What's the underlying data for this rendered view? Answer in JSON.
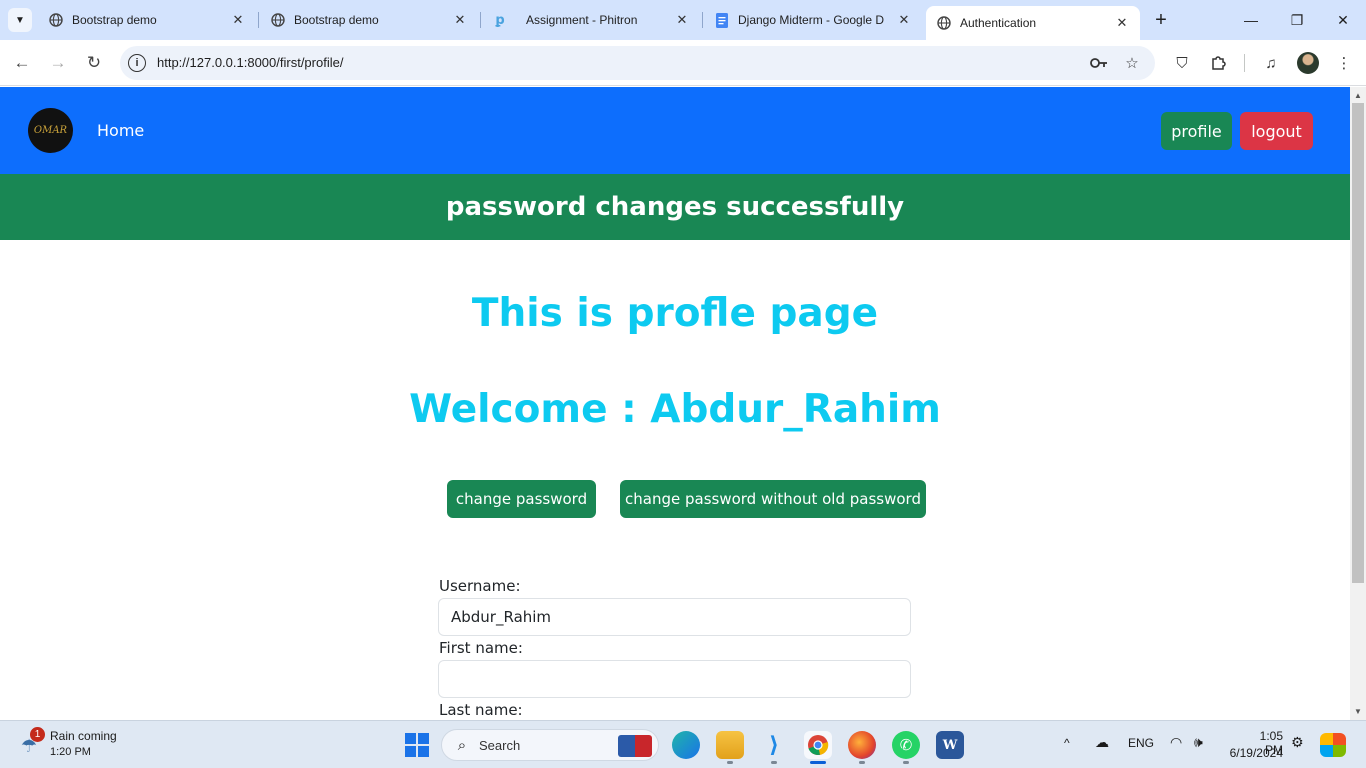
{
  "browser": {
    "tabs": [
      {
        "title": "Bootstrap demo",
        "icon": "globe-icon",
        "active": false
      },
      {
        "title": "Bootstrap demo",
        "icon": "globe-icon",
        "active": false
      },
      {
        "title": "Assignment - Phitron",
        "icon": "phitron-icon",
        "active": false
      },
      {
        "title": "Django Midterm - Google D",
        "icon": "google-docs-icon",
        "active": false
      },
      {
        "title": "Authentication",
        "icon": "globe-icon",
        "active": true
      }
    ],
    "url": "http://127.0.0.1:8000/first/profile/"
  },
  "navbar": {
    "logo_text": "OMAR",
    "home_label": "Home",
    "profile_label": "profile",
    "logout_label": "logout",
    "bg_color": "#0d6efd"
  },
  "alert": {
    "message": "password changes successfully",
    "color": "#198754"
  },
  "main": {
    "title": "This is profle page",
    "welcome": "Welcome : Abdur_Rahim",
    "change_password_label": "change password",
    "change_password_no_old_label": "change password without old password",
    "heading_color": "#0dcaf0"
  },
  "form": {
    "username_label": "Username:",
    "username_value": "Abdur_Rahim",
    "first_name_label": "First name:",
    "first_name_value": "",
    "last_name_label": "Last name:"
  },
  "taskbar": {
    "weather_badge": "1",
    "weather_title": "Rain coming",
    "weather_time": "1:20 PM",
    "search_placeholder": "Search",
    "language": "ENG",
    "clock_time": "1:05 PM",
    "clock_date": "6/19/2024"
  }
}
